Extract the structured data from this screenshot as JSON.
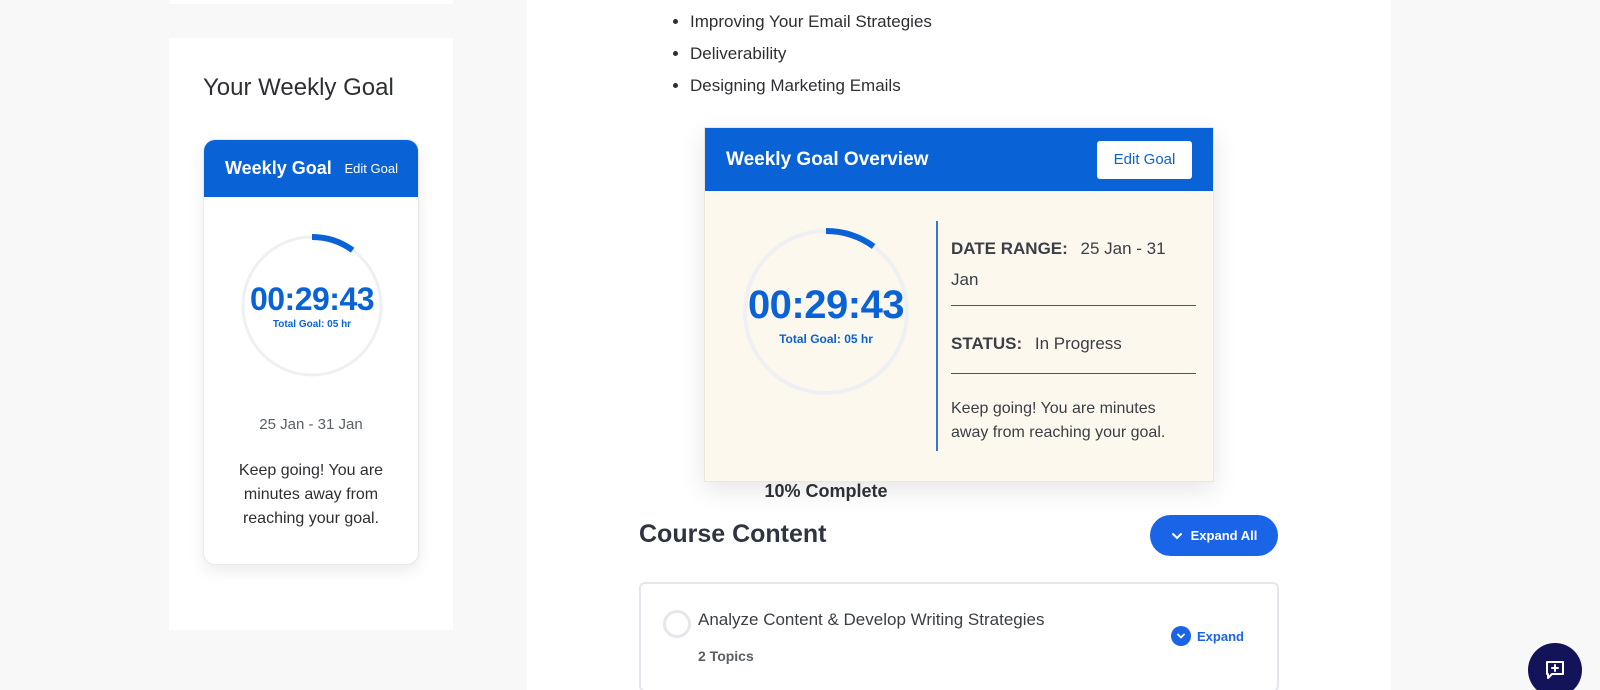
{
  "sidebar": {
    "title": "Your Weekly Goal",
    "widget": {
      "header_title": "Weekly Goal",
      "edit_label": "Edit Goal",
      "time": "00:29:43",
      "total_goal": "Total Goal: 05 hr",
      "date_range": "25 Jan - 31 Jan",
      "message": "Keep going! You are minutes away from reaching your goal.",
      "progress_fraction": 0.1
    }
  },
  "main": {
    "bullets": [
      "Improving Your Email Strategies",
      "Deliverability",
      "Designing Marketing Emails"
    ],
    "overview": {
      "title": "Weekly Goal Overview",
      "edit_label": "Edit Goal",
      "time": "00:29:43",
      "total_goal": "Total Goal: 05 hr",
      "percent_label": "10% Complete",
      "date_label": "DATE RANGE:",
      "date_value": "25 Jan - 31 Jan",
      "status_label": "STATUS:",
      "status_value": "In Progress",
      "message": "Keep going! You are minutes away from reaching your goal.",
      "progress_fraction": 0.1
    },
    "course": {
      "title": "Course Content",
      "expand_all_label": "Expand All",
      "lessons": [
        {
          "title": "Analyze Content & Develop Writing Strategies",
          "topics": "2 Topics",
          "expand_label": "Expand"
        }
      ]
    }
  },
  "colors": {
    "accent": "#0a63d6",
    "button_blue": "#1a64e8",
    "chat_fab": "#13135a",
    "overview_bg": "#fdf8ee"
  },
  "icons": {
    "expand_all": "chevron-down-icon",
    "lesson_expand": "chevron-down-icon",
    "chat": "chat-plus-icon"
  }
}
